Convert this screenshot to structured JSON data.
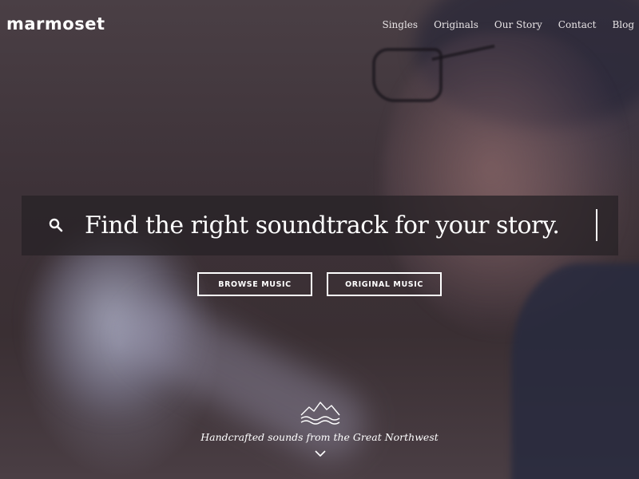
{
  "header": {
    "logo_text": "marmoset",
    "nav": [
      {
        "label": "Singles"
      },
      {
        "label": "Originals"
      },
      {
        "label": "Our Story"
      },
      {
        "label": "Contact"
      },
      {
        "label": "Blog"
      }
    ]
  },
  "search": {
    "placeholder": "Find the right soundtrack for your story.",
    "value": "",
    "icon": "search-icon"
  },
  "buttons": {
    "browse_label": "BROWSE MUSIC",
    "original_label": "ORIGINAL MUSIC"
  },
  "footer": {
    "tagline": "Handcrafted sounds from the Great Northwest",
    "mountain_icon": "mountain-icon",
    "scroll_icon": "chevron-down-icon"
  },
  "colors": {
    "text": "#ffffff",
    "search_bar_bg": "#282226",
    "background": "#3a3036"
  }
}
